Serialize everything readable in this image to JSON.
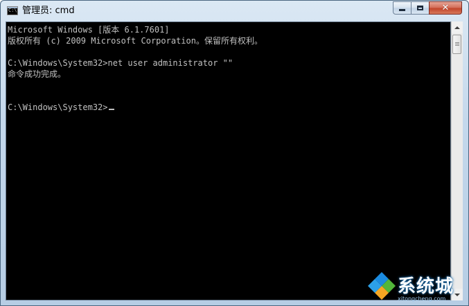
{
  "window": {
    "title": "管理员: cmd",
    "icon": "cmd-console-icon",
    "controls": {
      "minimize": "minimize-icon",
      "maximize": "maximize-icon",
      "close": "✕"
    }
  },
  "console": {
    "lines": [
      "Microsoft Windows [版本 6.1.7601]",
      "版权所有 (c) 2009 Microsoft Corporation。保留所有权利。",
      "",
      "C:\\Windows\\System32>net user administrator \"\"",
      "命令成功完成。",
      "",
      "",
      "C:\\Windows\\System32>"
    ],
    "text_color": "#c0c0c0",
    "background": "#000000"
  },
  "watermark": {
    "text": "系统城",
    "url": "xitongcheng.com",
    "colors": [
      "#1b8be0",
      "#52b63a",
      "#f5a623",
      "#2ca0e8"
    ]
  }
}
